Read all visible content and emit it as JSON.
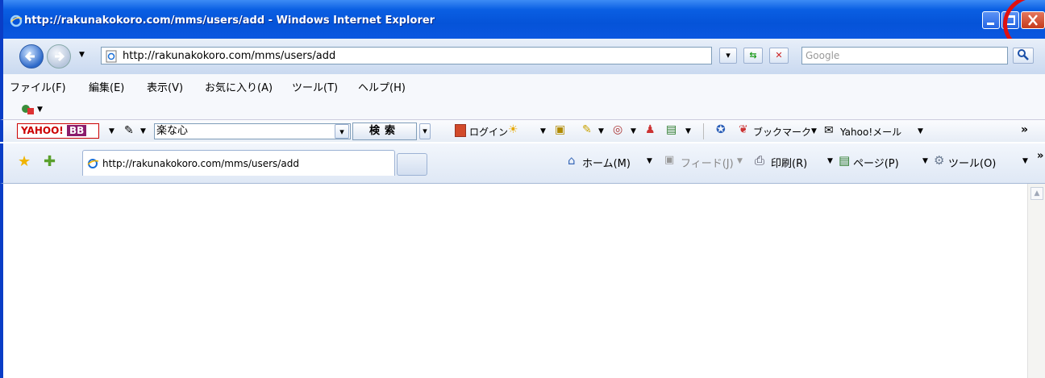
{
  "window": {
    "title": "http://rakunakokoro.com/mms/users/add - Windows Internet Explorer"
  },
  "navbar": {
    "address": "http://rakunakokoro.com/mms/users/add",
    "search_placeholder": "Google"
  },
  "menu": {
    "items": [
      "ファイル(F)",
      "編集(E)",
      "表示(V)",
      "お気に入り(A)",
      "ツール(T)",
      "ヘルプ(H)"
    ]
  },
  "yahoo_toolbar": {
    "logo_text": "YAHOO!",
    "logo_bb": "BB",
    "search_value": "楽な心",
    "search_button": "検索",
    "login": "ログイン",
    "bookmark": "ブックマーク",
    "mail": "Yahoo!メール"
  },
  "tabs": {
    "active_label": "http://rakunakokoro.com/mms/users/add"
  },
  "command_bar": {
    "home": "ホーム(M)",
    "feed": "フィード(J)",
    "print": "印刷(R)",
    "page": "ページ(P)",
    "tools": "ツール(O)"
  },
  "colors": {
    "titlebar": "#0553d8",
    "highlight_circle": "#e01010"
  }
}
